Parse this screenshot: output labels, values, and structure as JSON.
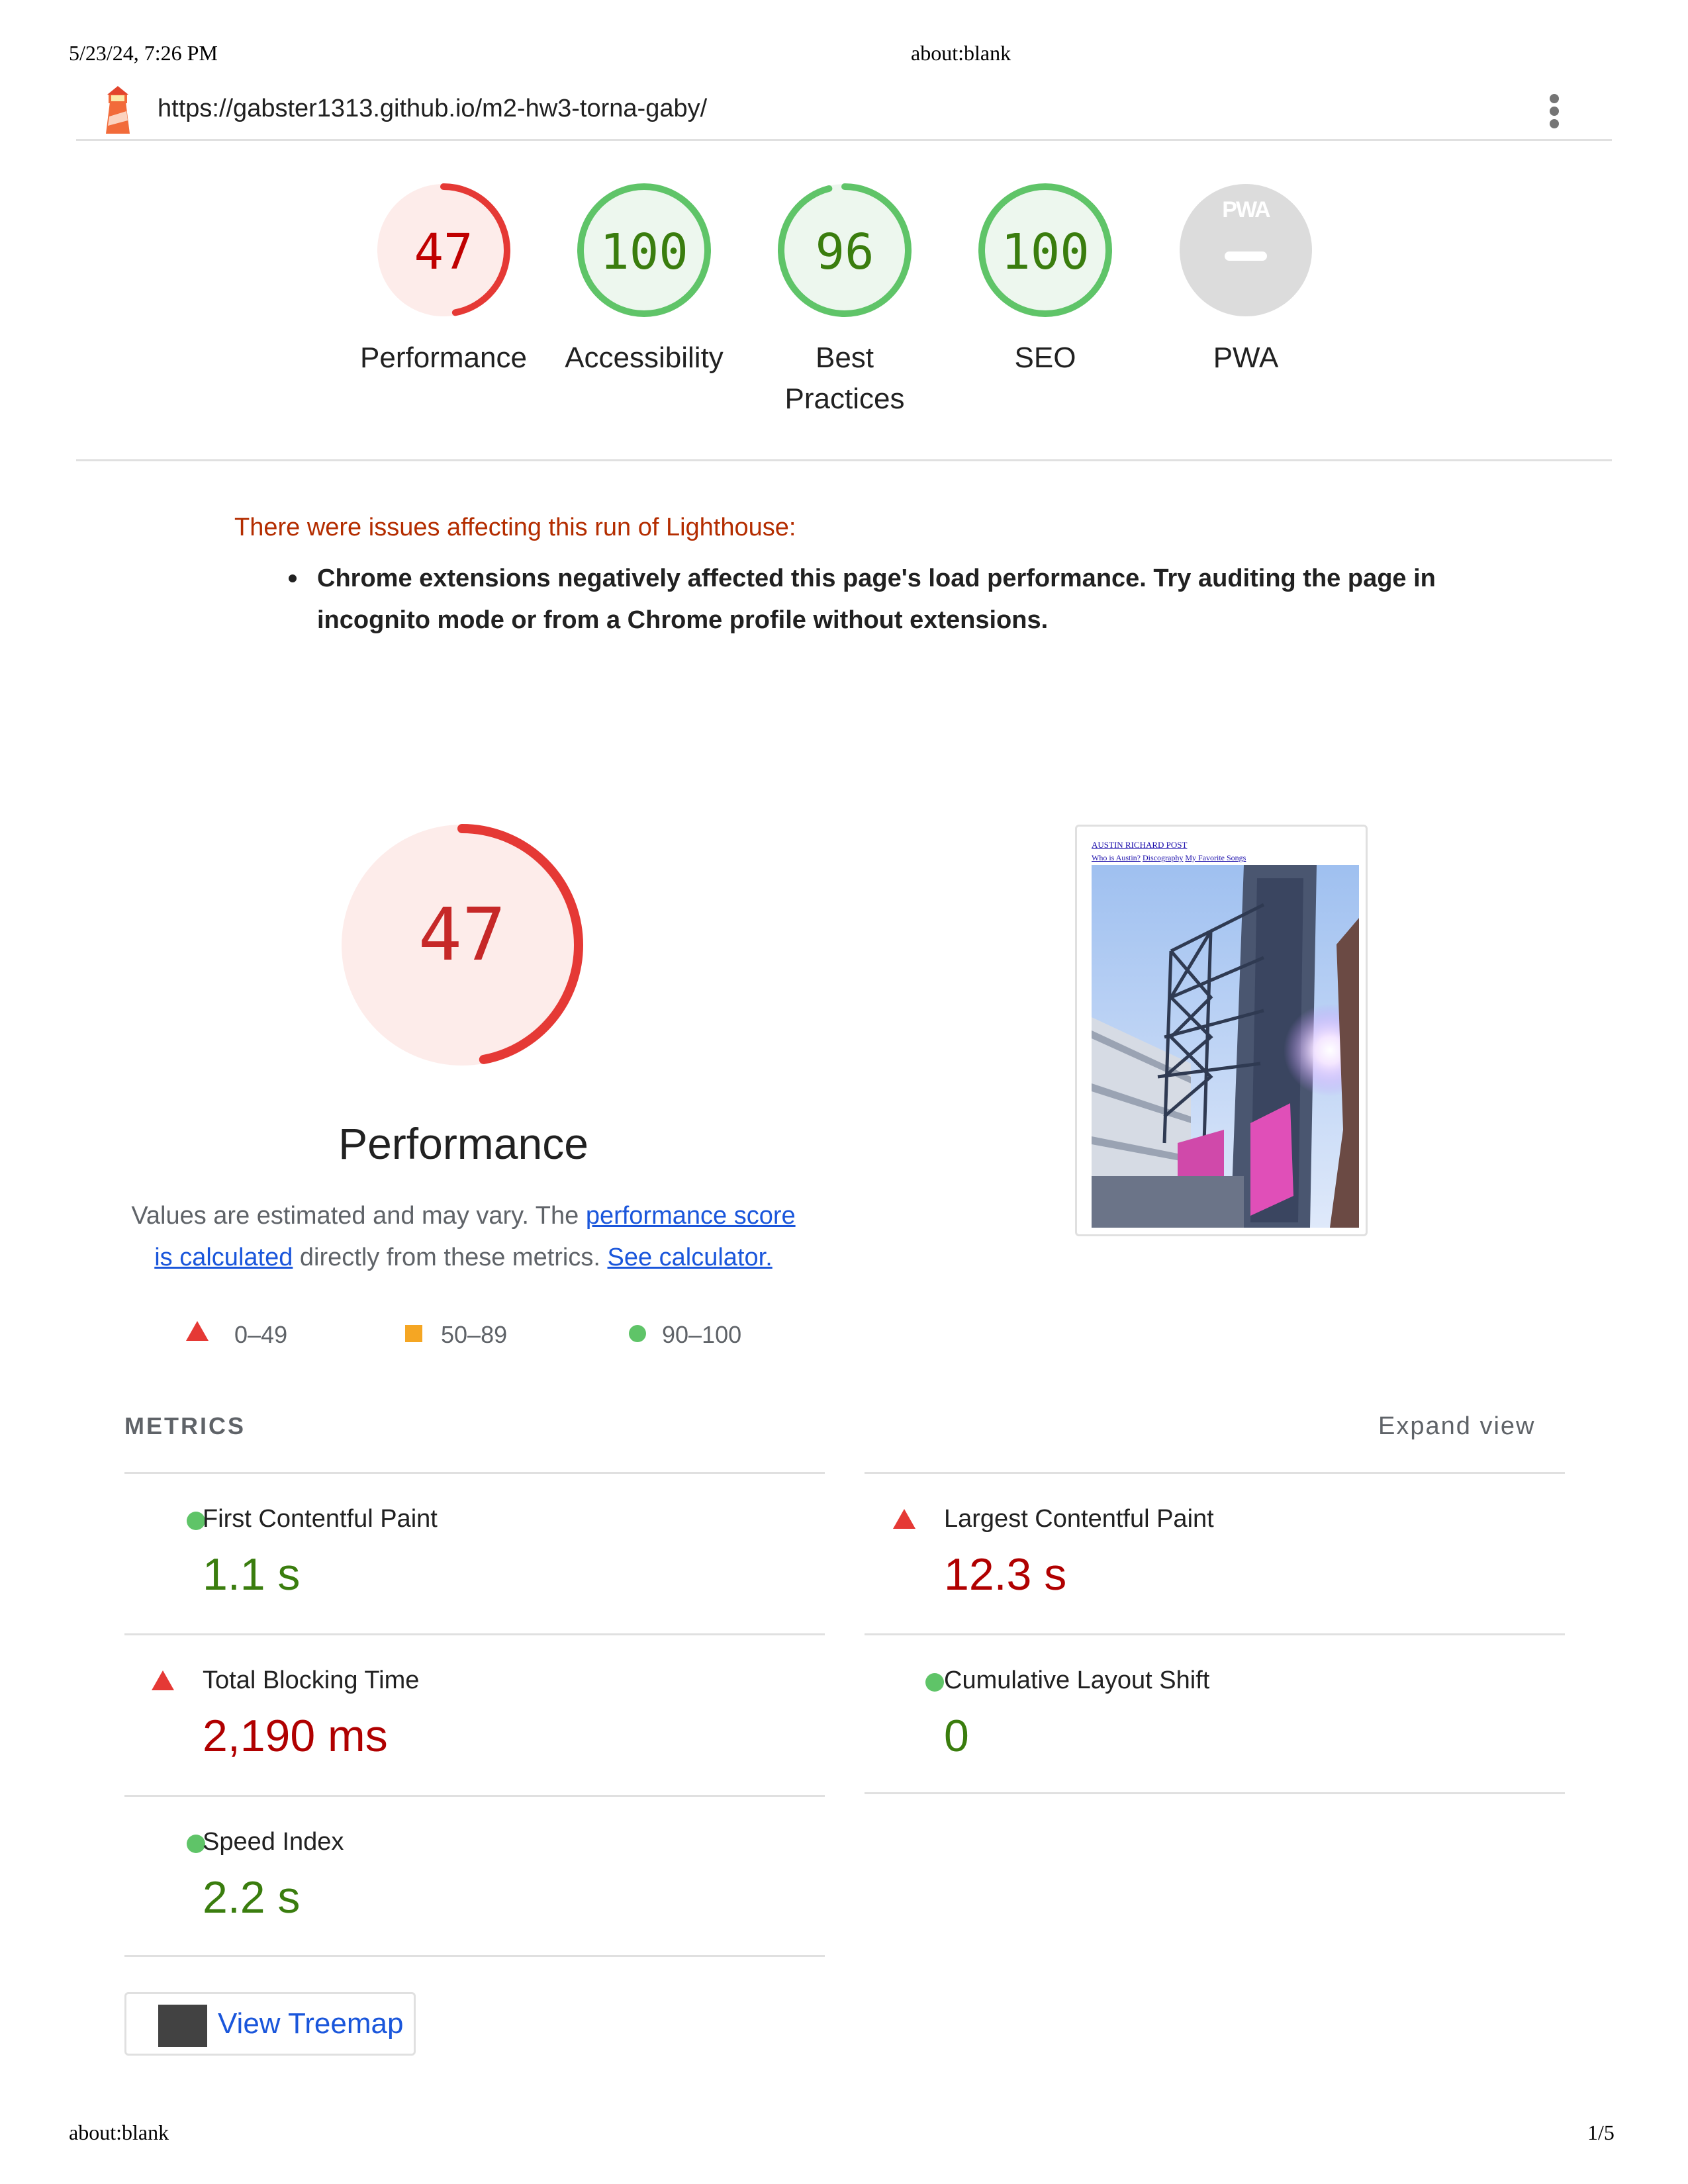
{
  "print_header": {
    "date": "5/23/24, 7:26 PM",
    "title": "about:blank"
  },
  "print_footer": {
    "url": "about:blank",
    "page": "1/5"
  },
  "topbar": {
    "url": "https://gabster1313.github.io/m2-hw3-torna-gaby/",
    "icon": "lighthouse-icon",
    "menu_icon": "more-vert-icon"
  },
  "categories": [
    {
      "label": "Performance",
      "score": "47",
      "level": 0.47,
      "color": "#e53935",
      "bg": "#fdecea",
      "text_color": "#c00000"
    },
    {
      "label": "Accessibility",
      "score": "100",
      "level": 1.0,
      "color": "#5fc468",
      "bg": "#edf7ee",
      "text_color": "#3a7d0e"
    },
    {
      "label": "Best Practices",
      "score": "96",
      "level": 0.96,
      "color": "#5fc468",
      "bg": "#edf7ee",
      "text_color": "#3a7d0e"
    },
    {
      "label": "SEO",
      "score": "100",
      "level": 1.0,
      "color": "#5fc468",
      "bg": "#edf7ee",
      "text_color": "#3a7d0e"
    },
    {
      "label": "PWA",
      "badge": "PWA",
      "color": "#dcdcdc"
    }
  ],
  "warning": {
    "title": "There were issues affecting this run of Lighthouse:",
    "line1": "Chrome extensions negatively affected this page's load performance. Try auditing the page in",
    "line2": "incognito mode or from a Chrome profile without extensions."
  },
  "performance": {
    "score": "47",
    "level": 0.47,
    "title": "Performance",
    "desc_pre": "Values are estimated and may vary. The ",
    "desc_link1a": "performance score",
    "desc_link1b": "is calculated",
    "desc_mid": " directly from these metrics. ",
    "desc_link2": "See calculator.",
    "legend": [
      "0–49",
      "50–89",
      "90–100"
    ]
  },
  "screenshot": {
    "site_title": "AUSTIN RICHARD POST",
    "nav": [
      "Who is Austin?",
      "Discography",
      "My Favorite Songs"
    ]
  },
  "metrics": {
    "title": "METRICS",
    "expand": "Expand view",
    "fcp": {
      "name": "First Contentful Paint",
      "value": "1.1 s"
    },
    "lcp": {
      "name": "Largest Contentful Paint",
      "value": "12.3 s"
    },
    "tbt": {
      "name": "Total Blocking Time",
      "value": "2,190 ms"
    },
    "cls": {
      "name": "Cumulative Layout Shift",
      "value": "0"
    },
    "si": {
      "name": "Speed Index",
      "value": "2.2 s"
    }
  },
  "treemap": {
    "label": "View Treemap"
  }
}
